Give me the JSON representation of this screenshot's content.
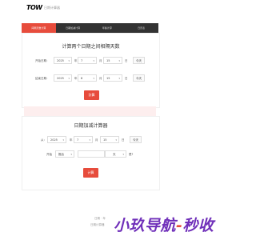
{
  "header": {
    "logo": "TOW",
    "subtitle": "日期计算器"
  },
  "tabs": [
    {
      "label": "间隔天数计算",
      "active": true
    },
    {
      "label": "日期加减计算",
      "active": false
    },
    {
      "label": "年龄计算",
      "active": false
    },
    {
      "label": "日历表",
      "active": false
    }
  ],
  "panel1": {
    "title": "计算两个日期之间相隔天数",
    "start_label": "开始日期：",
    "end_label": "结束日期：",
    "start": {
      "year": "2025",
      "month": "7",
      "day": "15"
    },
    "end": {
      "year": "2025",
      "month": "8",
      "day": "15"
    },
    "year_unit": "年",
    "month_unit": "月",
    "day_unit": "日",
    "today_label": "今天",
    "calc_button": "計算"
  },
  "panel2": {
    "title": "日期加减计算器",
    "from_label": "从：",
    "start": {
      "year": "2025",
      "month": "7",
      "day": "15"
    },
    "year_unit": "年",
    "month_unit": "月",
    "day_unit": "日",
    "today_label": "今天",
    "op_label": "开始",
    "op_value": "推后",
    "amount_value": "",
    "unit_value": "天",
    "question": "是?",
    "calc_button": "计算"
  },
  "footer": {
    "line1": "日期 · 年",
    "line2": "日期计算器"
  },
  "watermark": {
    "part1": "小玖导航",
    "dash": "-",
    "part2": "秒收"
  }
}
